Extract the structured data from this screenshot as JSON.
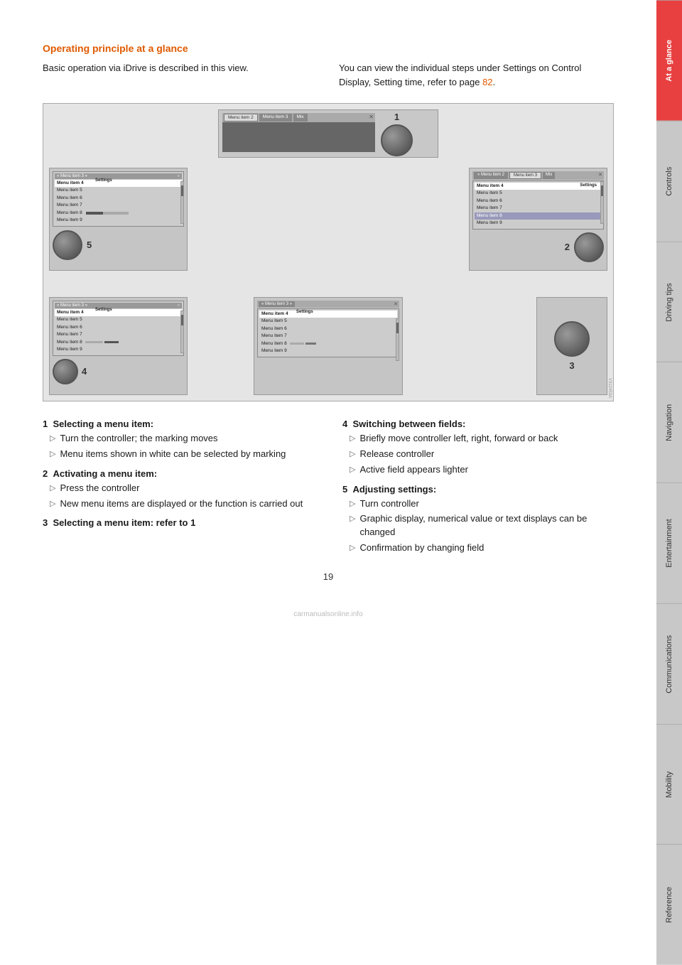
{
  "page": {
    "number": "19",
    "title": "Operating principle at a glance"
  },
  "sidebar": {
    "tabs": [
      {
        "id": "at-a-glance",
        "label": "At a glance",
        "active": true
      },
      {
        "id": "controls",
        "label": "Controls",
        "active": false
      },
      {
        "id": "driving-tips",
        "label": "Driving tips",
        "active": false
      },
      {
        "id": "navigation",
        "label": "Navigation",
        "active": false
      },
      {
        "id": "entertainment",
        "label": "Entertainment",
        "active": false
      },
      {
        "id": "communications",
        "label": "Communications",
        "active": false
      },
      {
        "id": "mobility",
        "label": "Mobility",
        "active": false
      },
      {
        "id": "reference",
        "label": "Reference",
        "active": false
      }
    ]
  },
  "intro": {
    "col1": "Basic operation via iDrive is described in this view.",
    "col2_part1": "You can view the individual steps under Settings on Control Display, Setting time, refer to page ",
    "col2_link": "82",
    "col2_part2": "."
  },
  "diagram": {
    "watermark": "V312453A"
  },
  "list_items": {
    "left": [
      {
        "number": "1",
        "title": "Selecting a menu item:",
        "subitems": [
          "Turn the controller; the marking moves",
          "Menu items shown in white can be selected by marking"
        ]
      },
      {
        "number": "2",
        "title": "Activating a menu item:",
        "subitems": [
          "Press the controller",
          "New menu items are displayed or the function is carried out"
        ]
      },
      {
        "number": "3",
        "title": "Selecting a menu item: refer to 1",
        "subitems": []
      }
    ],
    "right": [
      {
        "number": "4",
        "title": "Switching between fields:",
        "subitems": [
          "Briefly move controller left, right, forward or back",
          "Release controller",
          "Active field appears lighter"
        ]
      },
      {
        "number": "5",
        "title": "Adjusting settings:",
        "subitems": [
          "Turn controller",
          "Graphic display, numerical value or text displays can be changed",
          "Confirmation by changing field"
        ]
      }
    ]
  },
  "menu_panel_data": {
    "title_left": "« Menu item 3 »",
    "title_right": "« Menu item 2",
    "items": [
      "Menu item 4",
      "Menu item 5",
      "Menu item 6",
      "Menu item 7",
      "Menu item 8",
      "Menu item 9"
    ],
    "settings": "Settings"
  }
}
